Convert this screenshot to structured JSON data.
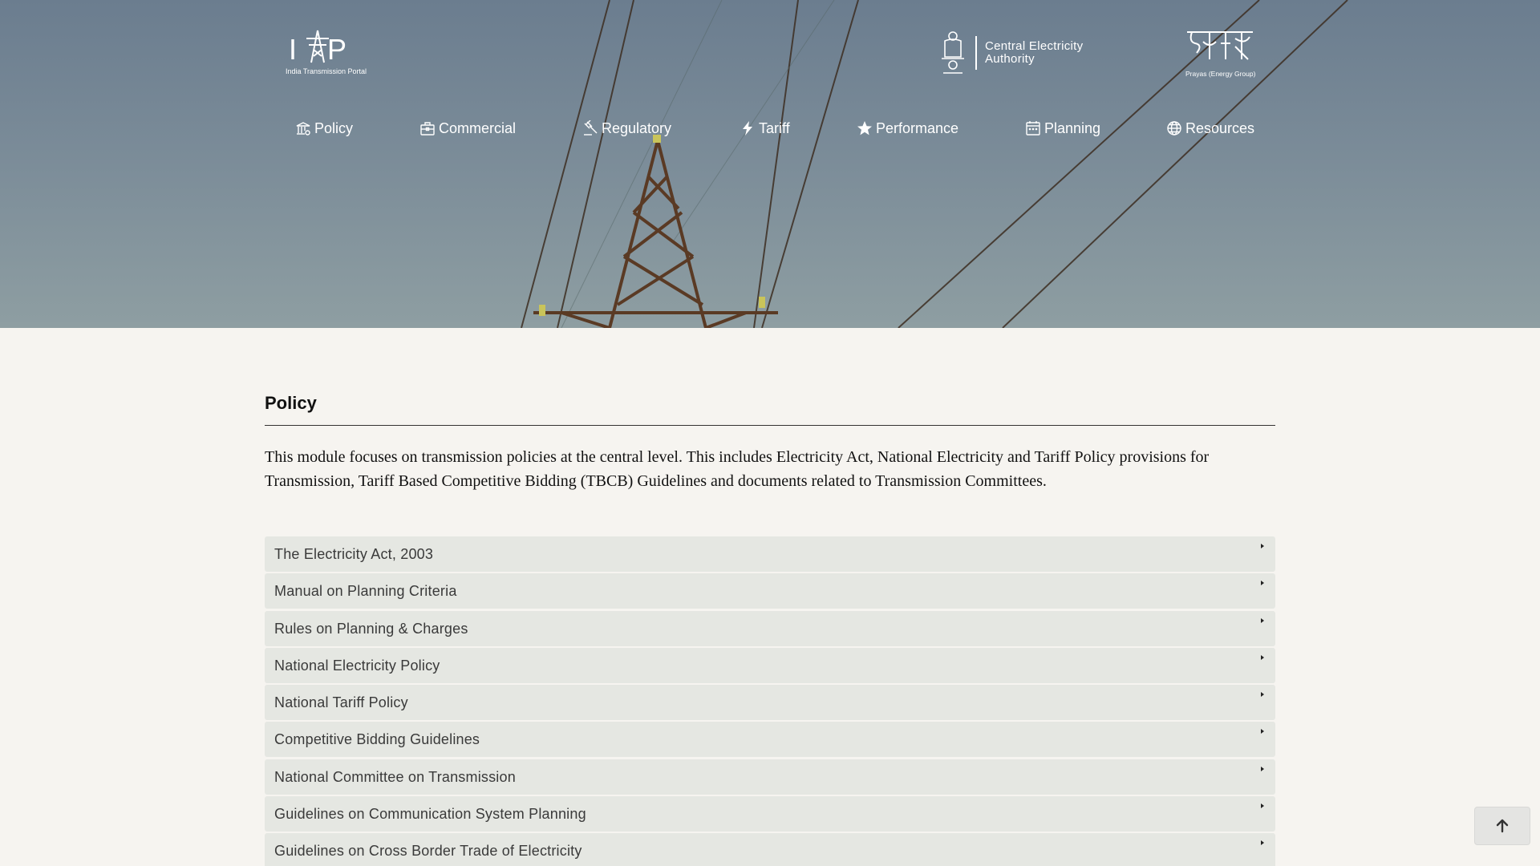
{
  "header": {
    "logo_itp": {
      "letters": [
        "I",
        "P"
      ],
      "subtitle": "India Transmission Portal"
    },
    "logo_cea": {
      "line1": "Central Electricity",
      "line2": "Authority"
    },
    "logo_prayas": {
      "subtitle": "Prayas (Energy Group)"
    }
  },
  "nav": {
    "items": [
      {
        "label": "Policy",
        "icon": "policy-icon"
      },
      {
        "label": "Commercial",
        "icon": "briefcase-icon"
      },
      {
        "label": "Regulatory",
        "icon": "gavel-icon"
      },
      {
        "label": "Tariff",
        "icon": "lightning-icon"
      },
      {
        "label": "Performance",
        "icon": "star-icon"
      },
      {
        "label": "Planning",
        "icon": "calendar-icon"
      },
      {
        "label": "Resources",
        "icon": "globe-icon"
      }
    ]
  },
  "main": {
    "title": "Policy",
    "intro": "This module focuses on transmission policies at the central level. This includes Electricity Act, National Electricity and Tariff Policy provisions for Transmission, Tariff Based Competitive Bidding (TBCB) Guidelines and documents related to Transmission Committees.",
    "accordion": [
      "The Electricity Act, 2003",
      "Manual on Planning Criteria",
      "Rules on Planning & Charges",
      "National Electricity Policy",
      "National Tariff Policy",
      "Competitive Bidding Guidelines",
      "National Committee on Transmission",
      "Guidelines on Communication System Planning",
      "Guidelines on Cross Border Trade of Electricity"
    ]
  },
  "colors": {
    "background": "#f6f4f0",
    "accordion_bg": "#e5e7e2",
    "hero_top": "#6b7d8f",
    "hero_bottom": "#8e9ea2"
  }
}
